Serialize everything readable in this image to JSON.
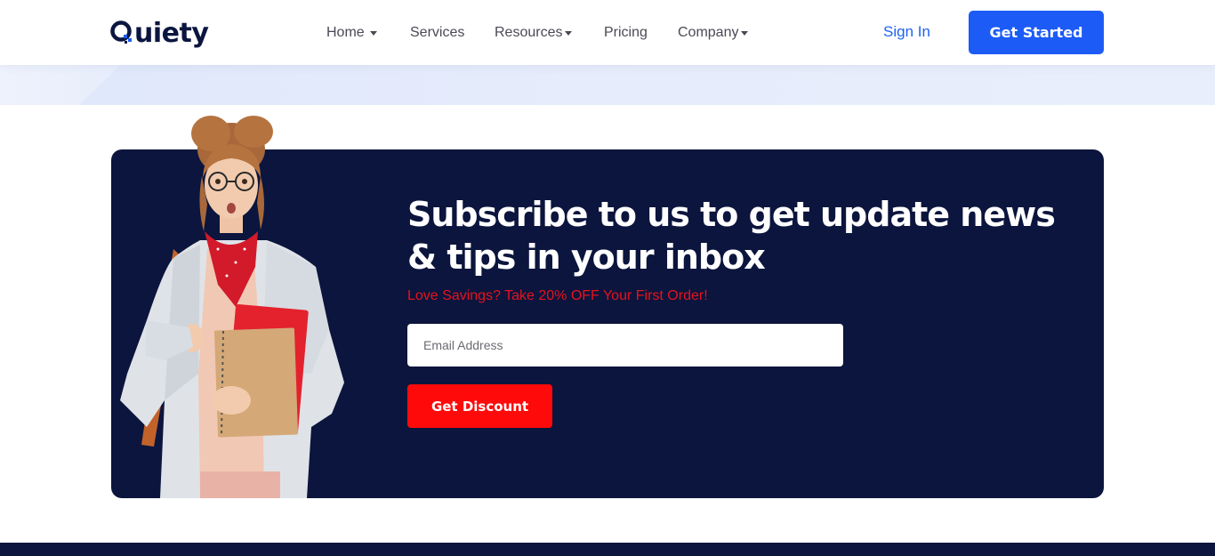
{
  "header": {
    "logo_text": "uiety",
    "nav": [
      {
        "label": "Home",
        "has_caret": true
      },
      {
        "label": "Services",
        "has_caret": false
      },
      {
        "label": "Resources",
        "has_caret": true
      },
      {
        "label": "Pricing",
        "has_caret": false
      },
      {
        "label": "Company",
        "has_caret": true
      }
    ],
    "signin_label": "Sign In",
    "cta_label": "Get Started"
  },
  "subscribe": {
    "headline": "Subscribe to us to get update news & tips in your inbox",
    "offer": "Love Savings? Take 20% OFF Your First Order!",
    "email_placeholder": "Email Address",
    "button_label": "Get Discount"
  },
  "colors": {
    "brand_blue": "#1c5bf5",
    "navy": "#0b153d",
    "accent_red": "#ff0a0a",
    "offer_red": "#e8121d"
  },
  "icons": [
    "logo-q-icon",
    "caret-down-icon"
  ]
}
